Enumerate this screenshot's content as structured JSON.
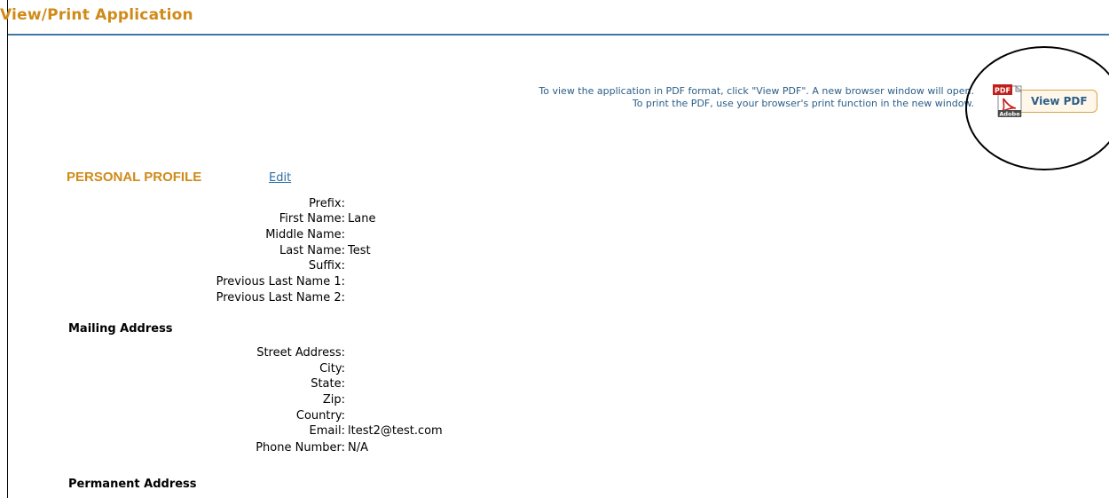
{
  "page": {
    "title": "View/Print Application"
  },
  "pdf": {
    "instruction_line1": "To view the application in PDF format, click \"View PDF\". A new browser window will open.",
    "instruction_line2": "To print the PDF, use your browser's print function in the new window.",
    "button_label": "View PDF",
    "icon_badge": "PDF",
    "icon_caption": "Adobe"
  },
  "personal_profile": {
    "heading": "PERSONAL PROFILE",
    "edit_label": "Edit",
    "fields": [
      {
        "label": "Prefix:",
        "value": ""
      },
      {
        "label": "First Name:",
        "value": "Lane"
      },
      {
        "label": "Middle Name:",
        "value": ""
      },
      {
        "label": "Last Name:",
        "value": "Test"
      },
      {
        "label": "Suffix:",
        "value": ""
      },
      {
        "label": "Previous Last Name 1:",
        "value": ""
      },
      {
        "label": "Previous Last Name 2:",
        "value": ""
      }
    ]
  },
  "mailing_address": {
    "heading": "Mailing Address",
    "fields": [
      {
        "label": "Street Address:",
        "value": ""
      },
      {
        "label": "City:",
        "value": ""
      },
      {
        "label": "State:",
        "value": ""
      },
      {
        "label": "Zip:",
        "value": ""
      },
      {
        "label": "Country:",
        "value": ""
      },
      {
        "label": "Email:",
        "value": "ltest2@test.com"
      },
      {
        "label": "Phone Number:",
        "value": "N/A"
      }
    ]
  },
  "permanent_address": {
    "heading": "Permanent Address"
  },
  "colors": {
    "title": "#d08a18",
    "rule": "#3d7aa8",
    "link": "#2b6ea8",
    "instruction_text": "#2b5e88",
    "button_border": "#d9a34c"
  }
}
